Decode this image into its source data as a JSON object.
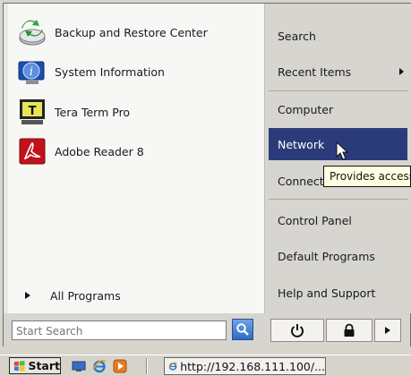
{
  "start_menu": {
    "programs": [
      {
        "label": "Backup and Restore Center",
        "icon": "backup-restore-icon"
      },
      {
        "label": "System Information",
        "icon": "system-information-icon"
      },
      {
        "label": "Tera Term Pro",
        "icon": "tera-term-icon"
      },
      {
        "label": "Adobe Reader 8",
        "icon": "adobe-reader-icon"
      }
    ],
    "all_programs_label": "All Programs",
    "search": {
      "placeholder": "Start Search"
    },
    "right_items": [
      {
        "label": "Search"
      },
      {
        "label": "Recent Items",
        "has_submenu": true
      },
      {
        "label": "Computer"
      },
      {
        "label": "Network",
        "active": true
      },
      {
        "label": "Connect To"
      },
      {
        "label": "Control Panel"
      },
      {
        "label": "Default Programs"
      },
      {
        "label": "Help and Support"
      }
    ],
    "tooltip": "Provides access t",
    "power_icons": [
      "power-icon",
      "lock-icon",
      "arrow-right-icon"
    ]
  },
  "taskbar": {
    "start_label": "Start",
    "task_button_label": "http://192.168.111.100/..."
  },
  "colors": {
    "highlight": "#2b3b7a",
    "tooltip_bg": "#ffffe1"
  }
}
